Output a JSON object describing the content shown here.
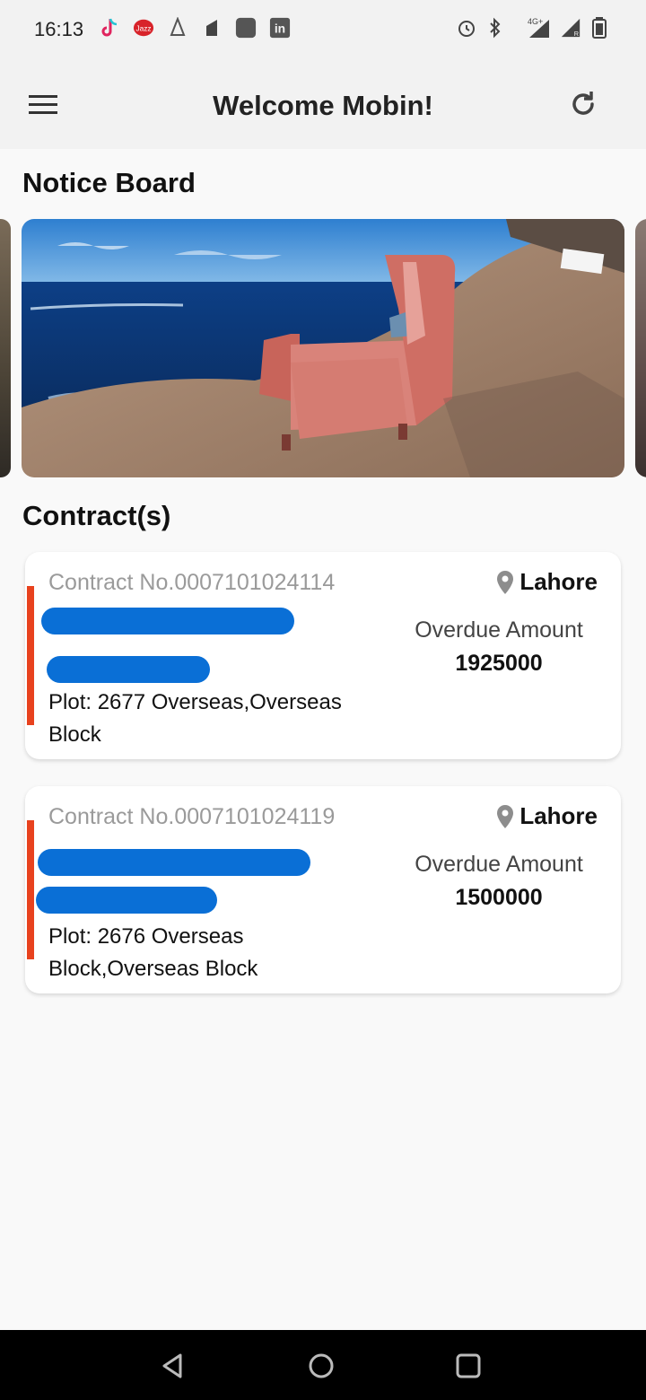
{
  "status_bar": {
    "time": "16:13",
    "left_icons": [
      "tiktok-icon",
      "jazz-icon",
      "app-icon",
      "app-icon-2",
      "square-icon",
      "linkedin-icon"
    ],
    "right_icons": [
      "alarm-icon",
      "bluetooth-icon",
      "signal-4g-icon",
      "signal-r-icon",
      "battery-icon"
    ],
    "network": "4G+"
  },
  "app_bar": {
    "title": "Welcome Mobin!",
    "menu_icon": "hamburger-menu-icon",
    "refresh_icon": "refresh-icon"
  },
  "notice_board": {
    "title": "Notice Board"
  },
  "contracts": {
    "title": "Contract(s)",
    "items": [
      {
        "contract_no": "Contract No.0007101024114",
        "location": "Lahore",
        "overdue_label": "Overdue Amount",
        "overdue_amount": "1925000",
        "plot": "Plot: 2677 Overseas,Overseas Block"
      },
      {
        "contract_no": "Contract No.0007101024119",
        "location": "Lahore",
        "overdue_label": "Overdue Amount",
        "overdue_amount": "1500000",
        "plot": "Plot: 2676 Overseas Block,Overseas Block"
      }
    ]
  },
  "colors": {
    "accent_bar": "#e8421e",
    "redaction": "#0a6fd6",
    "app_bar_bg": "#f2f2f2"
  },
  "nav_bar": {
    "icons": [
      "back-icon",
      "home-icon",
      "recents-icon"
    ]
  }
}
